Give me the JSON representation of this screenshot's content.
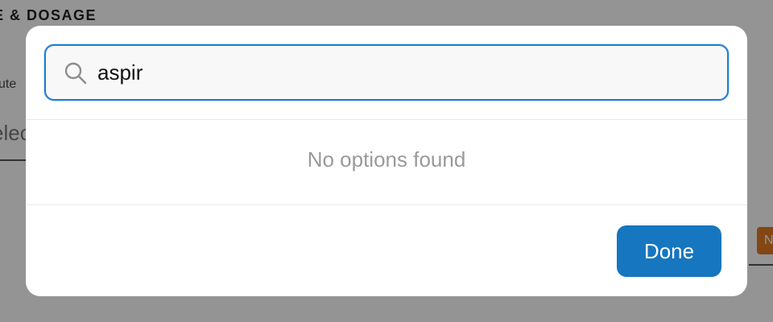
{
  "background": {
    "section_title": "E & DOSAGE",
    "route_label": "ute",
    "select_text": "elec",
    "badge_text": "N"
  },
  "modal": {
    "search": {
      "value": "aspir",
      "icon": "search-icon"
    },
    "empty_message": "No options found",
    "done_label": "Done"
  },
  "colors": {
    "accent": "#1676bf",
    "focus_border": "#1c7ed6",
    "badge": "#e07b22",
    "muted_text": "#9a9a9a"
  }
}
